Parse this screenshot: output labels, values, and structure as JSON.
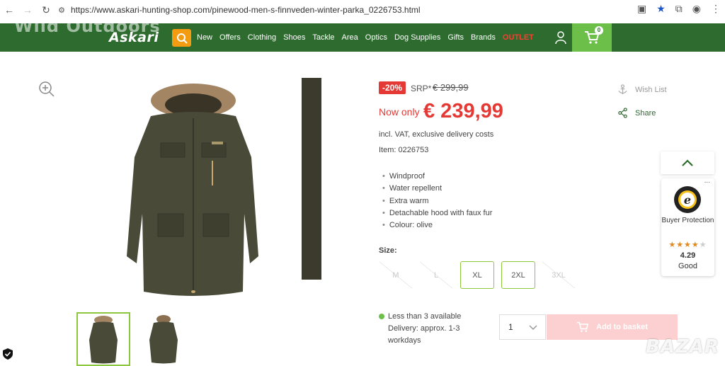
{
  "browser": {
    "url": "https://www.askari-hunting-shop.com/pinewood-men-s-finnveden-winter-parka_0226753.html"
  },
  "nav": {
    "ghost_text": "Wild Outdoors",
    "logo": "Askari",
    "menu": [
      "New",
      "Offers",
      "Clothing",
      "Shoes",
      "Tackle",
      "Area",
      "Optics",
      "Dog Supplies",
      "Gifts",
      "Brands",
      "OUTLET"
    ],
    "cart_count": "0",
    "colors": {
      "bar": "#2e6b2f",
      "cart": "#6cc04a",
      "search": "#f39c12",
      "outlet": "#ff3b30"
    }
  },
  "product": {
    "discount": "-20%",
    "srp_label": "SRP*",
    "old_price": "€ 299,99",
    "now_only": "Now only",
    "price": "€ 239,99",
    "vat_note": "incl. VAT, exclusive delivery costs",
    "item": "Item: 0226753",
    "features": [
      "Windproof",
      "Water repellent",
      "Extra warm",
      "Detachable hood with faux fur",
      "Colour: olive"
    ],
    "size_label": "Size:",
    "sizes": [
      {
        "label": "M",
        "available": false
      },
      {
        "label": "L",
        "available": false
      },
      {
        "label": "XL",
        "available": true
      },
      {
        "label": "2XL",
        "available": true
      },
      {
        "label": "3XL",
        "available": false
      }
    ],
    "availability": "Less than 3 available",
    "delivery": "Delivery: approx. 1-3 workdays",
    "quantity": "1",
    "add_to_basket": "Add to basket"
  },
  "actions": {
    "wish_list": "Wish List",
    "share": "Share"
  },
  "trusted": {
    "dots": "...",
    "buyer_protection": "Buyer Protection",
    "rating": "4.29",
    "rating_value": 4.29,
    "rating_word": "Good"
  },
  "watermark": "BAZAR"
}
